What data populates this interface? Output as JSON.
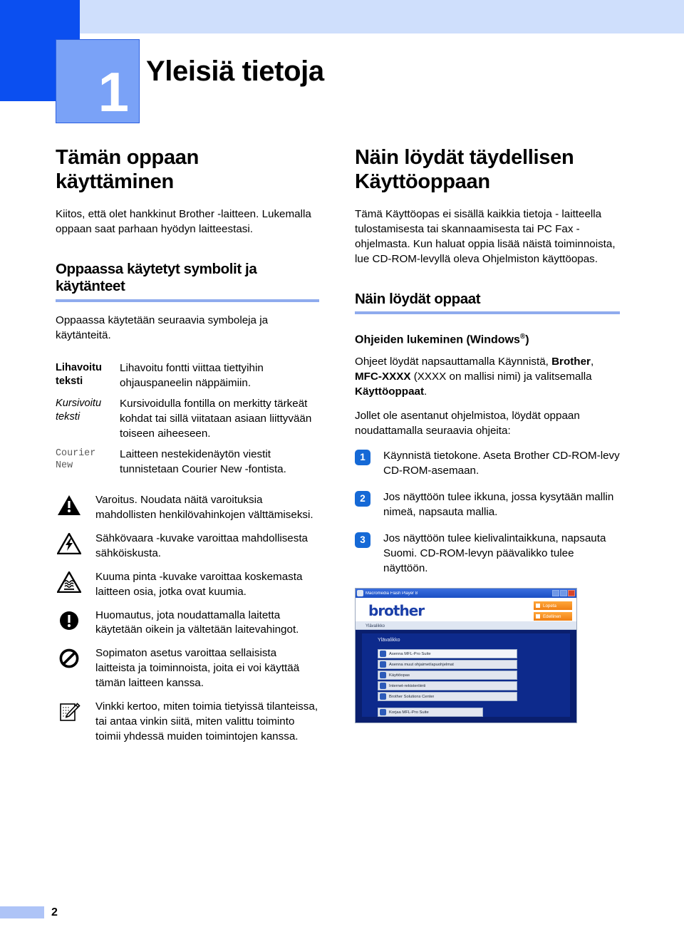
{
  "chapter": {
    "number": "1",
    "title": "Yleisiä tietoja"
  },
  "left_column": {
    "section_title": "Tämän oppaan käyttäminen",
    "intro": "Kiitos, että olet hankkinut Brother -laitteen. Lukemalla oppaan saat parhaan hyödyn laitteestasi.",
    "conventions_heading": "Oppaassa käytetyt symbolit ja käytänteet",
    "conventions_intro": "Oppaassa käytetään seuraavia symboleja ja käytänteitä.",
    "conventions": [
      {
        "term": "Lihavoitu teksti",
        "definition": "Lihavoitu fontti viittaa tiettyihin ohjauspaneelin näppäimiin.",
        "style": "bold"
      },
      {
        "term": "Kursivoitu teksti",
        "definition": "Kursivoidulla fontilla on merkitty tärkeät kohdat tai sillä viitataan asiaan liittyvään toiseen aiheeseen.",
        "style": "italic"
      },
      {
        "term": "Courier New",
        "definition": "Laitteen nestekidenäytön viestit tunnistetaan Courier New -fontista.",
        "style": "mono"
      }
    ],
    "notes": [
      {
        "icon": "warning-triangle-icon",
        "text": "Varoitus. Noudata näitä varoituksia mahdollisten henkilövahinkojen välttämiseksi."
      },
      {
        "icon": "electrical-hazard-icon",
        "text": "Sähkövaara -kuvake varoittaa mahdollisesta sähköiskusta."
      },
      {
        "icon": "hot-surface-icon",
        "text": "Kuuma pinta -kuvake varoittaa koskemasta laitteen osia, jotka ovat kuumia."
      },
      {
        "icon": "caution-circle-icon",
        "text": "Huomautus, jota noudattamalla laitetta käytetään oikein ja vältetään laitevahingot."
      },
      {
        "icon": "prohibition-icon",
        "text": "Sopimaton asetus varoittaa sellaisista laitteista ja toiminnoista, joita ei voi käyttää tämän laitteen kanssa."
      },
      {
        "icon": "note-pencil-icon",
        "text": "Vinkki kertoo, miten toimia tietyissä tilanteissa, tai antaa vinkin siitä, miten valittu toiminto toimii yhdessä muiden toimintojen kanssa."
      }
    ]
  },
  "right_column": {
    "section_title": "Näin löydät täydellisen Käyttöoppaan",
    "intro": "Tämä Käyttöopas ei sisällä kaikkia tietoja - laitteella tulostamisesta tai skannaamisesta tai PC Fax -ohjelmasta. Kun haluat oppia lisää näistä toiminnoista, lue CD-ROM-levyllä oleva Ohjelmiston käyttöopas.",
    "guides_heading": "Näin löydät oppaat",
    "windows_heading_pre": "Ohjeiden lukeminen (Windows",
    "windows_heading_reg": "®",
    "windows_heading_post": ")",
    "help_paragraph": {
      "p1": "Ohjeet löydät napsauttamalla Käynnistä, ",
      "b1": "Brother",
      "p2": ", ",
      "b2": "MFC-XXXX",
      "p3": " (XXXX on mallisi nimi) ja valitsemalla ",
      "b3": "Käyttöoppaat",
      "p4": "."
    },
    "not_installed": "Jollet ole asentanut ohjelmistoa, löydät oppaan noudattamalla seuraavia ohjeita:",
    "steps": [
      {
        "number": "1",
        "text": "Käynnistä tietokone. Aseta Brother CD-ROM-levy CD-ROM-asemaan."
      },
      {
        "number": "2",
        "text": "Jos näyttöön tulee ikkuna, jossa kysytään mallin nimeä, napsauta mallia."
      },
      {
        "number": "3",
        "text": "Jos näyttöön tulee kielivalintaikkuna, napsauta Suomi. CD-ROM-levyn päävalikko tulee näyttöön."
      }
    ],
    "screenshot": {
      "window_title": "Macromedia Flash Player 8",
      "logo": "brother",
      "breadcrumb": "Ylävalikko",
      "heading": "Ylävalikko",
      "buttons": [
        {
          "label": "Lopeta"
        },
        {
          "label": "Edellinen"
        }
      ],
      "menu_items": [
        {
          "label": "Asenna MFL-Pro Suite"
        },
        {
          "label": "Asenna muut ohjaimet/apuohjelmat"
        },
        {
          "label": "Käyttöopas"
        },
        {
          "label": "Internet-rekisteröinti"
        },
        {
          "label": "Brother Solutions Center"
        }
      ],
      "repair_item": {
        "label": "Korjaa MFL-Pro Suite"
      }
    }
  },
  "footer": {
    "page_number": "2"
  },
  "colors": {
    "banner_light": "#cfdffc",
    "banner_dark": "#0b4ff0",
    "badge": "#7aa2f7",
    "rule": "#8fabee",
    "step_badge": "#1569d6",
    "footer_bar": "#aec4f7"
  }
}
